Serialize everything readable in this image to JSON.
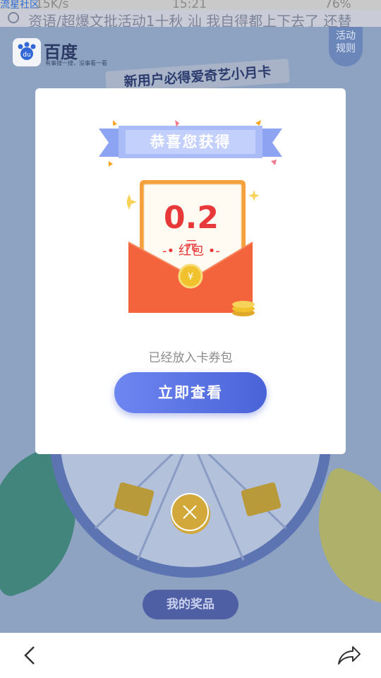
{
  "status_bar": {
    "source_label": "流星社区",
    "speed": "15K/s",
    "time": "15:21",
    "battery": "76%"
  },
  "marquee": {
    "text": "资语/超爆文批活动1十秋 汕 我自得都上下去了 还替"
  },
  "background_page": {
    "brand_name": "百度",
    "slogan": "有事搜一搜，没事看一看",
    "rules_button": "活动\n规则",
    "headline": "新用户必得爱奇艺小月卡",
    "my_prizes_button": "我的奖品"
  },
  "modal": {
    "ribbon_title": "恭喜您获得",
    "amount": "0.2",
    "unit": "元",
    "item_label": "红包",
    "message": "已经放入卡券包",
    "view_button": "立即查看"
  },
  "colors": {
    "accent_blue": "#5b74e6",
    "red_text": "#e8393a",
    "envelope_orange": "#f4643c",
    "gold": "#f2c12e"
  }
}
